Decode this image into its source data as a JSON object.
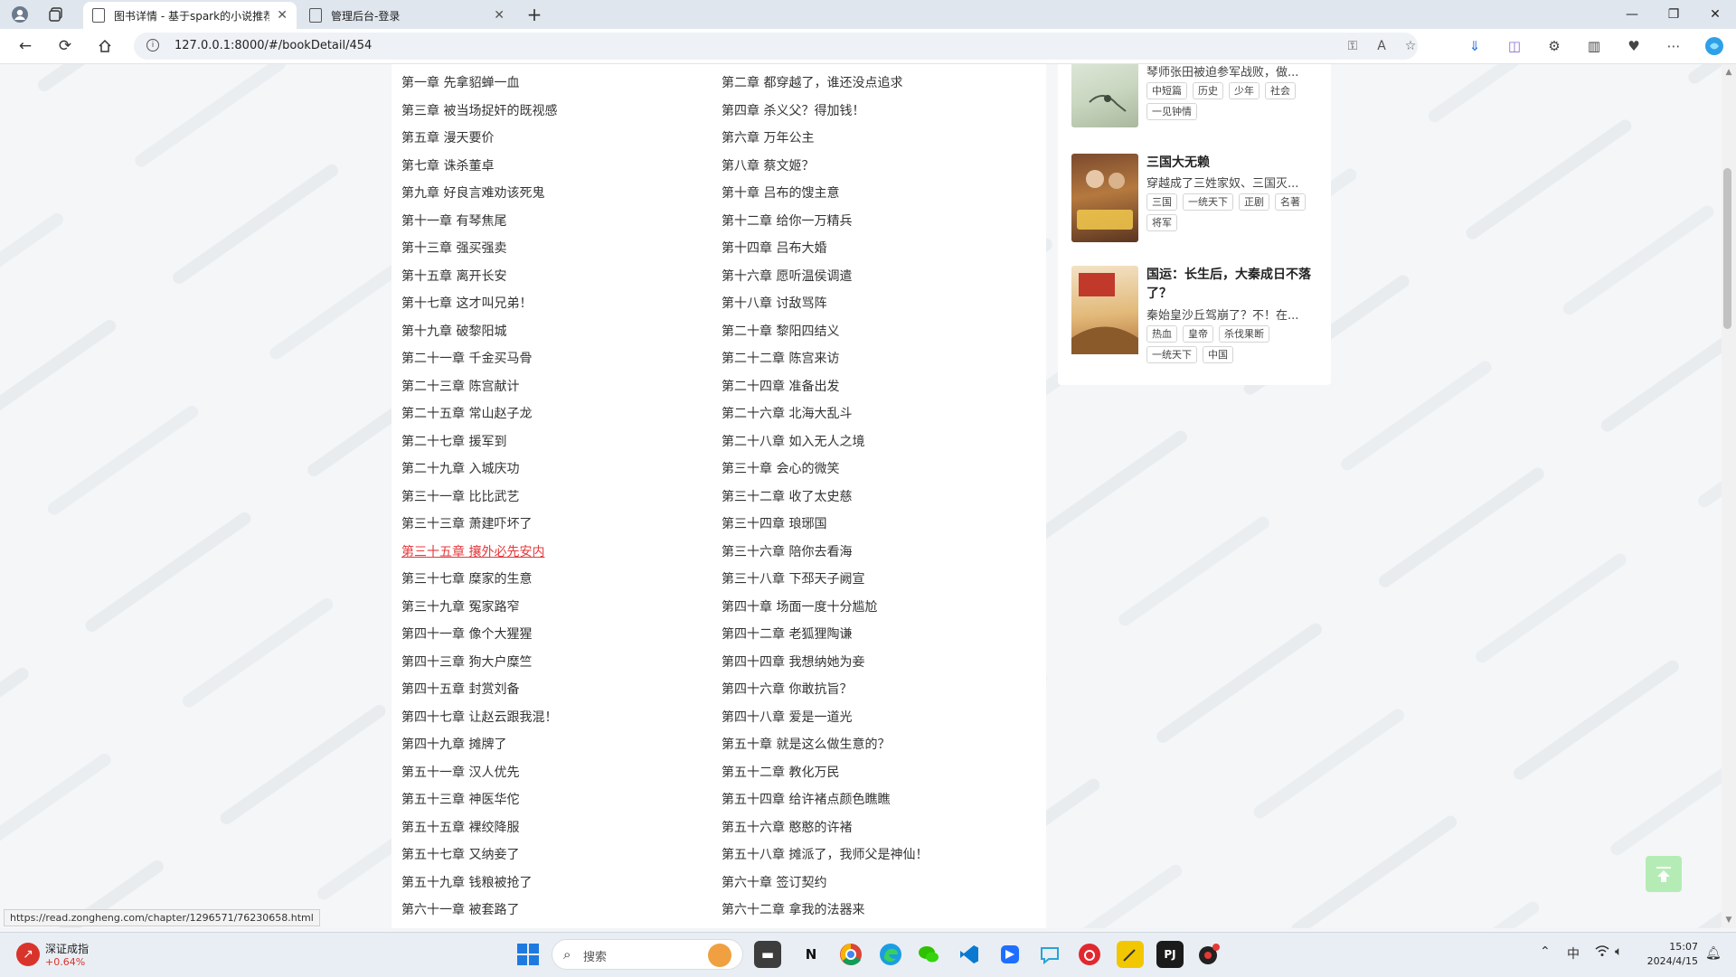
{
  "browser": {
    "tabs": [
      {
        "title": "图书详情 - 基于spark的小说推荐",
        "active": true
      },
      {
        "title": "管理后台-登录",
        "active": false
      }
    ],
    "url": "127.0.0.1:8000/#/bookDetail/454"
  },
  "chapters": [
    "第一章 先拿貂蝉一血",
    "第二章 都穿越了，谁还没点追求",
    "第三章 被当场捉奸的既视感",
    "第四章 杀义父？得加钱！",
    "第五章 漫天要价",
    "第六章 万年公主",
    "第七章 诛杀董卓",
    "第八章 蔡文姬？",
    "第九章 好良言难劝该死鬼",
    "第十章 吕布的馊主意",
    "第十一章 有琴焦尾",
    "第十二章 给你一万精兵",
    "第十三章 强买强卖",
    "第十四章 吕布大婚",
    "第十五章 离开长安",
    "第十六章 愿听温侯调遣",
    "第十七章 这才叫兄弟！",
    "第十八章 讨敌骂阵",
    "第十九章 破黎阳城",
    "第二十章 黎阳四结义",
    "第二十一章 千金买马骨",
    "第二十二章 陈宫来访",
    "第二十三章 陈宫献计",
    "第二十四章 准备出发",
    "第二十五章 常山赵子龙",
    "第二十六章 北海大乱斗",
    "第二十七章 援军到",
    "第二十八章 如入无人之境",
    "第二十九章 入城庆功",
    "第三十章 会心的微笑",
    "第三十一章 比比武艺",
    "第三十二章 收了太史慈",
    "第三十三章 萧建吓坏了",
    "第三十四章 琅琊国",
    "第三十五章 攘外必先安内",
    "第三十六章 陪你去看海",
    "第三十七章 糜家的生意",
    "第三十八章 下邳天子阙宣",
    "第三十九章 冤家路窄",
    "第四十章 场面一度十分尴尬",
    "第四十一章 像个大猩猩",
    "第四十二章 老狐狸陶谦",
    "第四十三章 狗大户糜竺",
    "第四十四章 我想纳她为妾",
    "第四十五章 封赏刘备",
    "第四十六章 你敢抗旨？",
    "第四十七章 让赵云跟我混！",
    "第四十八章 爱是一道光",
    "第四十九章 摊牌了",
    "第五十章 就是这么做生意的？",
    "第五十一章 汉人优先",
    "第五十二章 教化万民",
    "第五十三章 神医华佗",
    "第五十四章 给许褚点颜色瞧瞧",
    "第五十五章 裸绞降服",
    "第五十六章 憨憨的许褚",
    "第五十七章 又纳妾了",
    "第五十八章 摊派了，我师父是神仙！",
    "第五十九章 钱粮被抢了",
    "第六十章 签订契约",
    "第六十一章 被套路了",
    "第六十二章 拿我的法器来"
  ],
  "hovered_chapter_index": 34,
  "recommend": [
    {
      "title": "",
      "desc": "琴师张田被迫参军战败，做...",
      "tags": [
        "中短篇",
        "历史",
        "少年",
        "社会",
        "一见钟情"
      ]
    },
    {
      "title": "三国大无赖",
      "desc": "穿越成了三姓家奴、三国灭...",
      "tags": [
        "三国",
        "一统天下",
        "正剧",
        "名著",
        "将军"
      ]
    },
    {
      "title": "国运：长生后，大秦成日不落了？",
      "desc": "秦始皇沙丘驾崩了？不！在...",
      "tags": [
        "热血",
        "皇帝",
        "杀伐果断",
        "一统天下",
        "中国"
      ]
    }
  ],
  "status_url": "https://read.zongheng.com/chapter/1296571/76230658.html",
  "taskbar": {
    "stock_name": "深证成指",
    "stock_change": "+0.64%",
    "search_placeholder": "搜索",
    "ime": "中",
    "time": "15:07",
    "date": "2024/4/15"
  },
  "colors": {
    "hover_link": "#e4393c",
    "back_to_top": "#b5ecb5",
    "stock_up": "#d9342b"
  }
}
